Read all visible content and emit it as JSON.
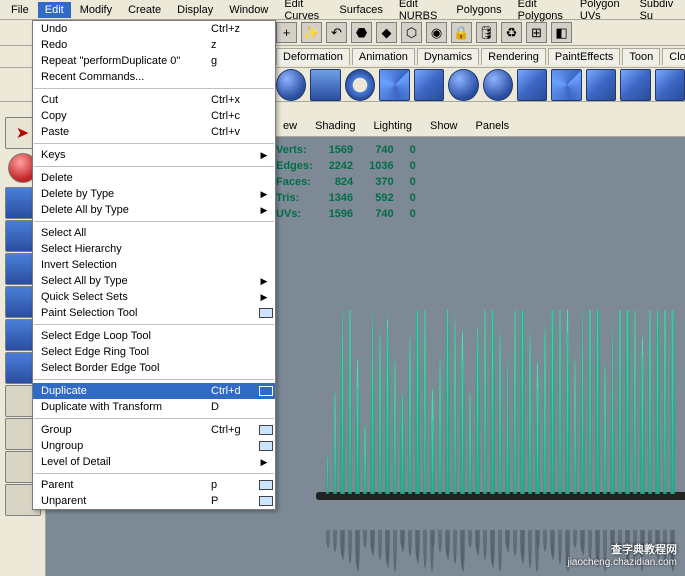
{
  "menubar": [
    "File",
    "Edit",
    "Modify",
    "Create",
    "Display",
    "Window",
    "Edit Curves",
    "Surfaces",
    "Edit NURBS",
    "Polygons",
    "Edit Polygons",
    "Polygon UVs",
    "Subdiv Su"
  ],
  "menubar_active_index": 1,
  "shelf_tabs": [
    "Deformation",
    "Animation",
    "Dynamics",
    "Rendering",
    "PaintEffects",
    "Toon",
    "Cloth"
  ],
  "panel_menus": [
    "ew",
    "Shading",
    "Lighting",
    "Show",
    "Panels"
  ],
  "dropdown": {
    "groups": [
      [
        {
          "label": "Undo",
          "shortcut": "Ctrl+z"
        },
        {
          "label": "Redo",
          "shortcut": "z"
        },
        {
          "label": "Repeat \"performDuplicate 0\"",
          "shortcut": "g"
        },
        {
          "label": "Recent Commands...",
          "shortcut": ""
        }
      ],
      [
        {
          "label": "Cut",
          "shortcut": "Ctrl+x"
        },
        {
          "label": "Copy",
          "shortcut": "Ctrl+c"
        },
        {
          "label": "Paste",
          "shortcut": "Ctrl+v"
        }
      ],
      [
        {
          "label": "Keys",
          "shortcut": "",
          "submenu": true
        }
      ],
      [
        {
          "label": "Delete",
          "shortcut": ""
        },
        {
          "label": "Delete by Type",
          "shortcut": "",
          "submenu": true
        },
        {
          "label": "Delete All by Type",
          "shortcut": "",
          "submenu": true
        }
      ],
      [
        {
          "label": "Select All",
          "shortcut": ""
        },
        {
          "label": "Select Hierarchy",
          "shortcut": ""
        },
        {
          "label": "Invert Selection",
          "shortcut": ""
        },
        {
          "label": "Select All by Type",
          "shortcut": "",
          "submenu": true
        },
        {
          "label": "Quick Select Sets",
          "shortcut": "",
          "submenu": true
        },
        {
          "label": "Paint Selection Tool",
          "shortcut": "",
          "opt": true
        }
      ],
      [
        {
          "label": "Select Edge Loop Tool",
          "shortcut": ""
        },
        {
          "label": "Select Edge Ring Tool",
          "shortcut": ""
        },
        {
          "label": "Select Border Edge Tool",
          "shortcut": ""
        }
      ],
      [
        {
          "label": "Duplicate",
          "shortcut": "Ctrl+d",
          "opt": true,
          "selected": true
        },
        {
          "label": "Duplicate with Transform",
          "shortcut": "D"
        }
      ],
      [
        {
          "label": "Group",
          "shortcut": "Ctrl+g",
          "opt": true
        },
        {
          "label": "Ungroup",
          "shortcut": "",
          "opt": true
        },
        {
          "label": "Level of Detail",
          "shortcut": "",
          "submenu": true
        }
      ],
      [
        {
          "label": "Parent",
          "shortcut": "p",
          "opt": true
        },
        {
          "label": "Unparent",
          "shortcut": "P",
          "opt": true
        }
      ]
    ]
  },
  "hud": {
    "rows": [
      {
        "label": "Verts:",
        "a": "1569",
        "b": "740",
        "c": "0"
      },
      {
        "label": "Edges:",
        "a": "2242",
        "b": "1036",
        "c": "0"
      },
      {
        "label": "Faces:",
        "a": "824",
        "b": "370",
        "c": "0"
      },
      {
        "label": "Tris:",
        "a": "1346",
        "b": "592",
        "c": "0"
      },
      {
        "label": "UVs:",
        "a": "1596",
        "b": "740",
        "c": "0"
      }
    ]
  },
  "watermark": {
    "line1": "查字典教程网",
    "line2": "jiaocheng.chazidian.com"
  },
  "toolbar_glyphs": [
    "+",
    "✨",
    "↶",
    "⬣",
    "◆",
    "⬡",
    "◉",
    "🔒",
    "🛢",
    "♻",
    "⊞",
    "◧"
  ]
}
